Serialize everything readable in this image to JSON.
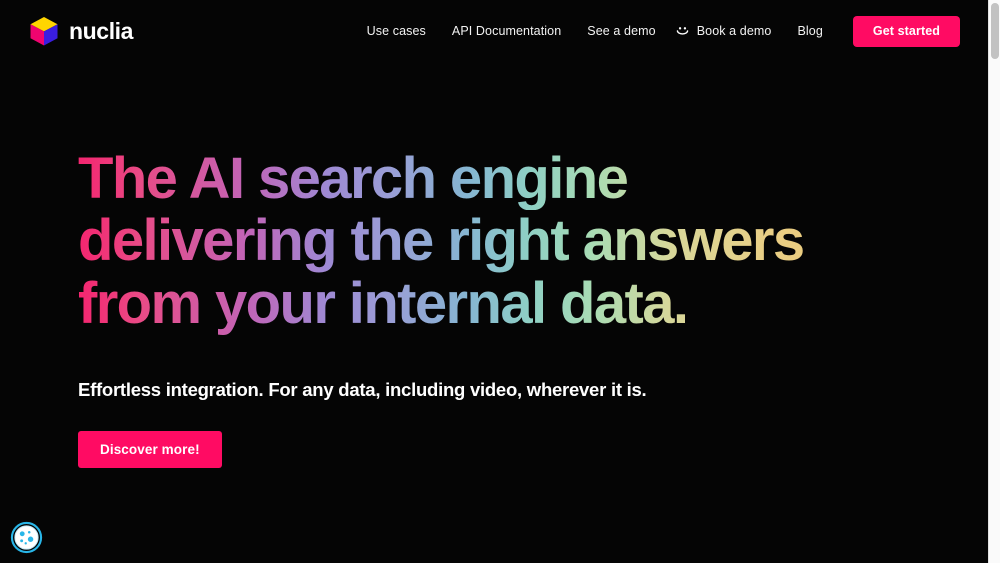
{
  "brand": {
    "name": "nuclia",
    "logo_icon": "cube-logo-icon",
    "logo_colors": {
      "top": "#FFD500",
      "left": "#F0046F",
      "right": "#3A1DE0"
    }
  },
  "nav": {
    "items": [
      {
        "label": "Use cases",
        "icon": null
      },
      {
        "label": "API Documentation",
        "icon": null
      },
      {
        "label": "See a demo",
        "icon": null
      },
      {
        "label": "Book a demo",
        "icon": "smiley-face-icon"
      },
      {
        "label": "Blog",
        "icon": null
      }
    ],
    "cta": {
      "label": "Get started",
      "color": "#FF0B63",
      "text_color": "#FFFFFF"
    }
  },
  "hero": {
    "headline_lines": [
      "The AI search engine",
      "delivering the right answers",
      "from your internal data."
    ],
    "headline_gradient": {
      "from": "#F4256F",
      "mid": "#9A9ED6",
      "to": "#EDC978"
    },
    "subheadline": "Effortless integration. For any data, including video, wherever it is.",
    "cta": {
      "label": "Discover more!",
      "color": "#FF0B63",
      "text_color": "#FFFFFF"
    }
  },
  "cookie_widget": {
    "icon": "cookie-icon",
    "color": "#29B6E8"
  },
  "scrollbar": {
    "track_color": "#FAFAFA",
    "thumb_color": "#C2C2C2"
  },
  "background_color": "#050505"
}
